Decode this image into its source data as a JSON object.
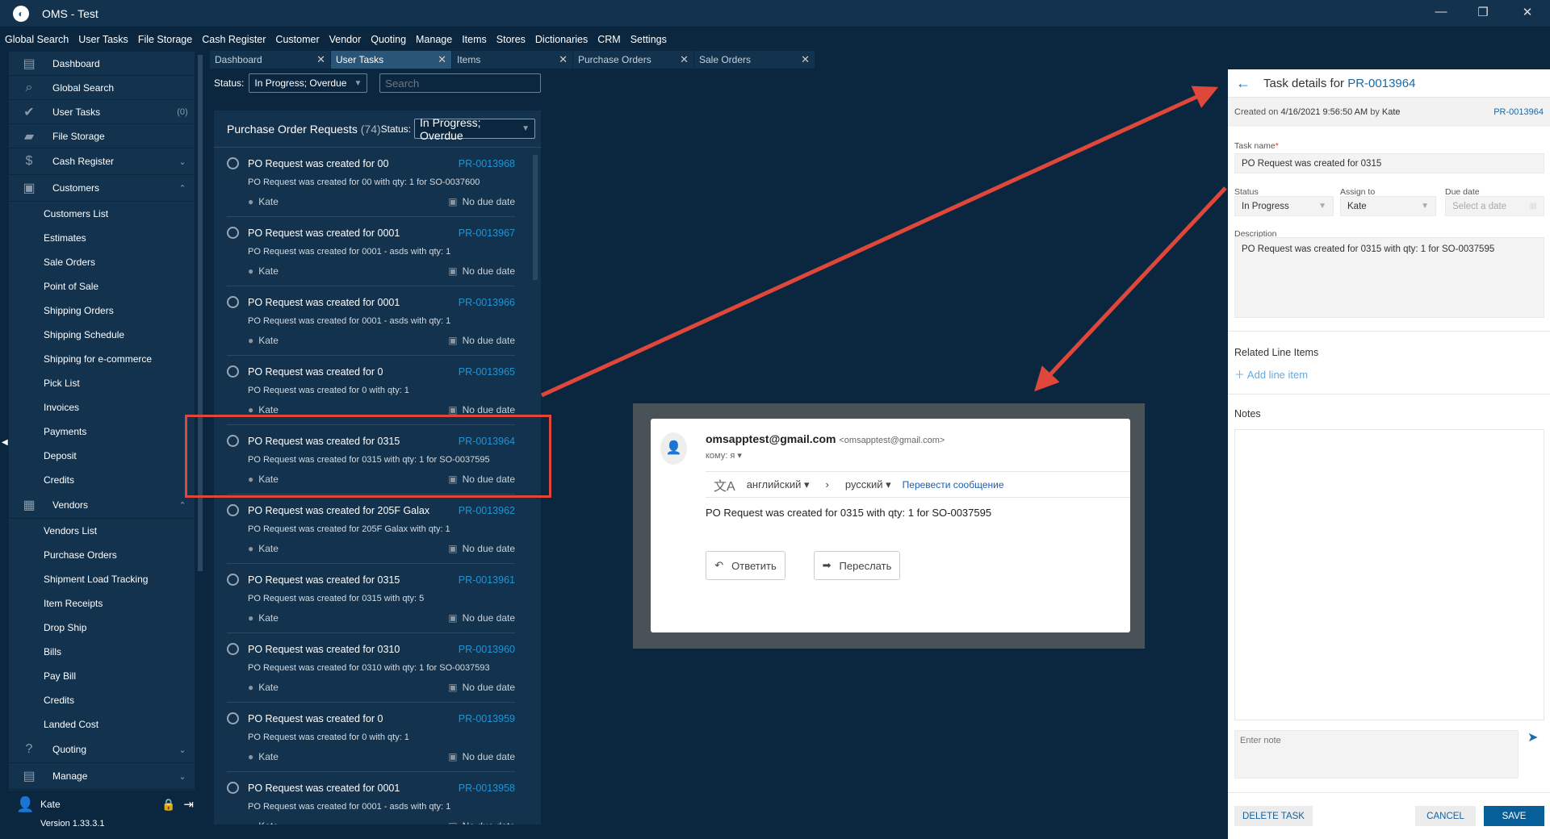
{
  "app": {
    "title": "OMS - Test",
    "logo": "globe-logo"
  },
  "menu": [
    "Global Search",
    "User Tasks",
    "File Storage",
    "Cash Register",
    "Customer",
    "Vendor",
    "Quoting",
    "Manage",
    "Items",
    "Stores",
    "Dictionaries",
    "CRM",
    "Settings"
  ],
  "sidebar": {
    "top": [
      {
        "label": "Dashboard",
        "icon": "dashboard-icon",
        "glyph": "▤"
      },
      {
        "label": "Global Search",
        "icon": "search-icon",
        "glyph": "⌕"
      },
      {
        "label": "User Tasks",
        "icon": "check-circle-icon",
        "glyph": "✔",
        "badge": "(0)"
      },
      {
        "label": "File Storage",
        "icon": "folder-icon",
        "glyph": "▰"
      }
    ],
    "cash_register": "Cash Register",
    "customers": {
      "label": "Customers",
      "items": [
        "Customers List",
        "Estimates",
        "Sale Orders",
        "Point of Sale",
        "Shipping Orders",
        "Shipping Schedule",
        "Shipping for e-commerce",
        "Pick List",
        "Invoices",
        "Payments",
        "Deposit",
        "Credits"
      ]
    },
    "vendors": {
      "label": "Vendors",
      "items": [
        "Vendors List",
        "Purchase Orders",
        "Shipment Load Tracking",
        "Item Receipts",
        "Drop Ship",
        "Bills",
        "Pay Bill",
        "Credits",
        "Landed Cost"
      ]
    },
    "quoting": "Quoting",
    "manage": "Manage",
    "user": "Kate",
    "version": "Version 1.33.3.1"
  },
  "tabs": [
    {
      "label": "Dashboard",
      "active": false
    },
    {
      "label": "User Tasks",
      "active": true
    },
    {
      "label": "Items",
      "active": false
    },
    {
      "label": "Purchase Orders",
      "active": false
    },
    {
      "label": "Sale Orders",
      "active": false
    }
  ],
  "filter": {
    "status_label": "Status:",
    "status_value": "In Progress; Overdue",
    "search_placeholder": "Search"
  },
  "list": {
    "title": "Purchase Order Requests",
    "count": "(74)",
    "status_label": "Status:",
    "status_value": "In Progress; Overdue",
    "items": [
      {
        "title": "PO Request was created for 00",
        "id": "PR-0013968",
        "desc": "PO Request was created for 00 with qty: 1 for SO-0037600",
        "user": "Kate",
        "due": "No due date"
      },
      {
        "title": "PO Request was created for 0001",
        "id": "PR-0013967",
        "desc": "PO Request was created for 0001 - asds with qty: 1",
        "user": "Kate",
        "due": "No due date"
      },
      {
        "title": "PO Request was created for 0001",
        "id": "PR-0013966",
        "desc": "PO Request was created for 0001 - asds with qty: 1",
        "user": "Kate",
        "due": "No due date"
      },
      {
        "title": "PO Request was created for 0",
        "id": "PR-0013965",
        "desc": "PO Request was created for 0 with qty: 1",
        "user": "Kate",
        "due": "No due date"
      },
      {
        "title": "PO Request was created for 0315",
        "id": "PR-0013964",
        "desc": "PO Request was created for 0315 with qty: 1 for SO-0037595",
        "user": "Kate",
        "due": "No due date"
      },
      {
        "title": "PO Request was created for 205F Galax",
        "id": "PR-0013962",
        "desc": "PO Request was created for 205F Galax with qty: 1",
        "user": "Kate",
        "due": "No due date"
      },
      {
        "title": "PO Request was created for 0315",
        "id": "PR-0013961",
        "desc": "PO Request was created for 0315 with qty: 5",
        "user": "Kate",
        "due": "No due date"
      },
      {
        "title": "PO Request was created for 0310",
        "id": "PR-0013960",
        "desc": "PO Request was created for 0310 with qty: 1 for SO-0037593",
        "user": "Kate",
        "due": "No due date"
      },
      {
        "title": "PO Request was created for 0",
        "id": "PR-0013959",
        "desc": "PO Request was created for 0 with qty: 1",
        "user": "Kate",
        "due": "No due date"
      },
      {
        "title": "PO Request was created for 0001",
        "id": "PR-0013958",
        "desc": "PO Request was created for 0001 - asds with qty: 1",
        "user": "Kate",
        "due": "No due date"
      }
    ]
  },
  "email": {
    "from": "omsapptest@gmail.com",
    "from_addr": "<omsapptest@gmail.com>",
    "to": "кому: я",
    "src_lang": "английский",
    "dst_lang": "русский",
    "translate": "Перевести сообщение",
    "body": "PO Request was created for 0315 with qty: 1 for SO-0037595",
    "reply": "Ответить",
    "forward": "Переслать"
  },
  "detail": {
    "title_prefix": "Task details for",
    "title_id": "PR-0013964",
    "created_prefix": "Created on",
    "created_date": "4/16/2021 9:56:50 AM",
    "created_by_word": "by",
    "created_by": "Kate",
    "ref": "PR-0013964",
    "task_name_label": "Task name",
    "task_name": "PO Request was created for 0315",
    "status_label": "Status",
    "status": "In Progress",
    "assign_label": "Assign to",
    "assign": "Kate",
    "due_label": "Due date",
    "due_placeholder": "Select a date",
    "description_label": "Description",
    "description": "PO Request was created for 0315 with qty: 1 for SO-0037595",
    "related_label": "Related Line Items",
    "add_line": "Add line item",
    "notes_label": "Notes",
    "note_placeholder": "Enter note",
    "delete": "DELETE TASK",
    "cancel": "CANCEL",
    "save": "SAVE"
  },
  "colors": {
    "accent": "#1a6aa5",
    "annotation": "#e0473b",
    "background": "#0b2740",
    "panel": "#12324d"
  }
}
